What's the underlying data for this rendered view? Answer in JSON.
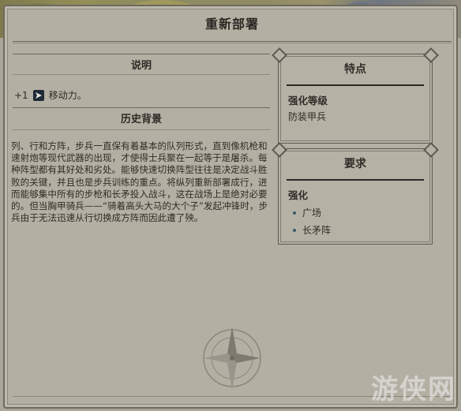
{
  "window": {
    "title": "重新部署"
  },
  "description": {
    "heading": "说明",
    "effect_value": "+1",
    "effect_icon": "movement-arrow-icon",
    "effect_label": "移动力。"
  },
  "history": {
    "heading": "历史背景",
    "text": "列、行和方阵，步兵一直保有着基本的队列形式，直到像机枪和速射炮等现代武器的出现，才使得士兵聚在一起等于是屠杀。每种阵型都有其好处和劣处。能够快速切换阵型往往是决定战斗胜败的关键，并且也是步兵训练的重点。将纵列重新部署成行，进而能够集中所有的步枪和长矛投入战斗，这在战场上是绝对必要的。但当胸甲骑兵——“骑着高头大马的大个子”发起冲锋时，步兵由于无法迅速从行切换成方阵而因此遭了殃。"
  },
  "traits": {
    "heading": "特点",
    "category": "强化等级",
    "value": "防装甲兵"
  },
  "requirements": {
    "heading": "要求",
    "category": "强化",
    "items": [
      "广场",
      "长矛阵"
    ]
  },
  "watermark": "游侠网",
  "colors": {
    "panel": "#b4afa3",
    "border": "#6e695e",
    "text": "#2f2c27",
    "bullet": "#3c5a6a"
  }
}
